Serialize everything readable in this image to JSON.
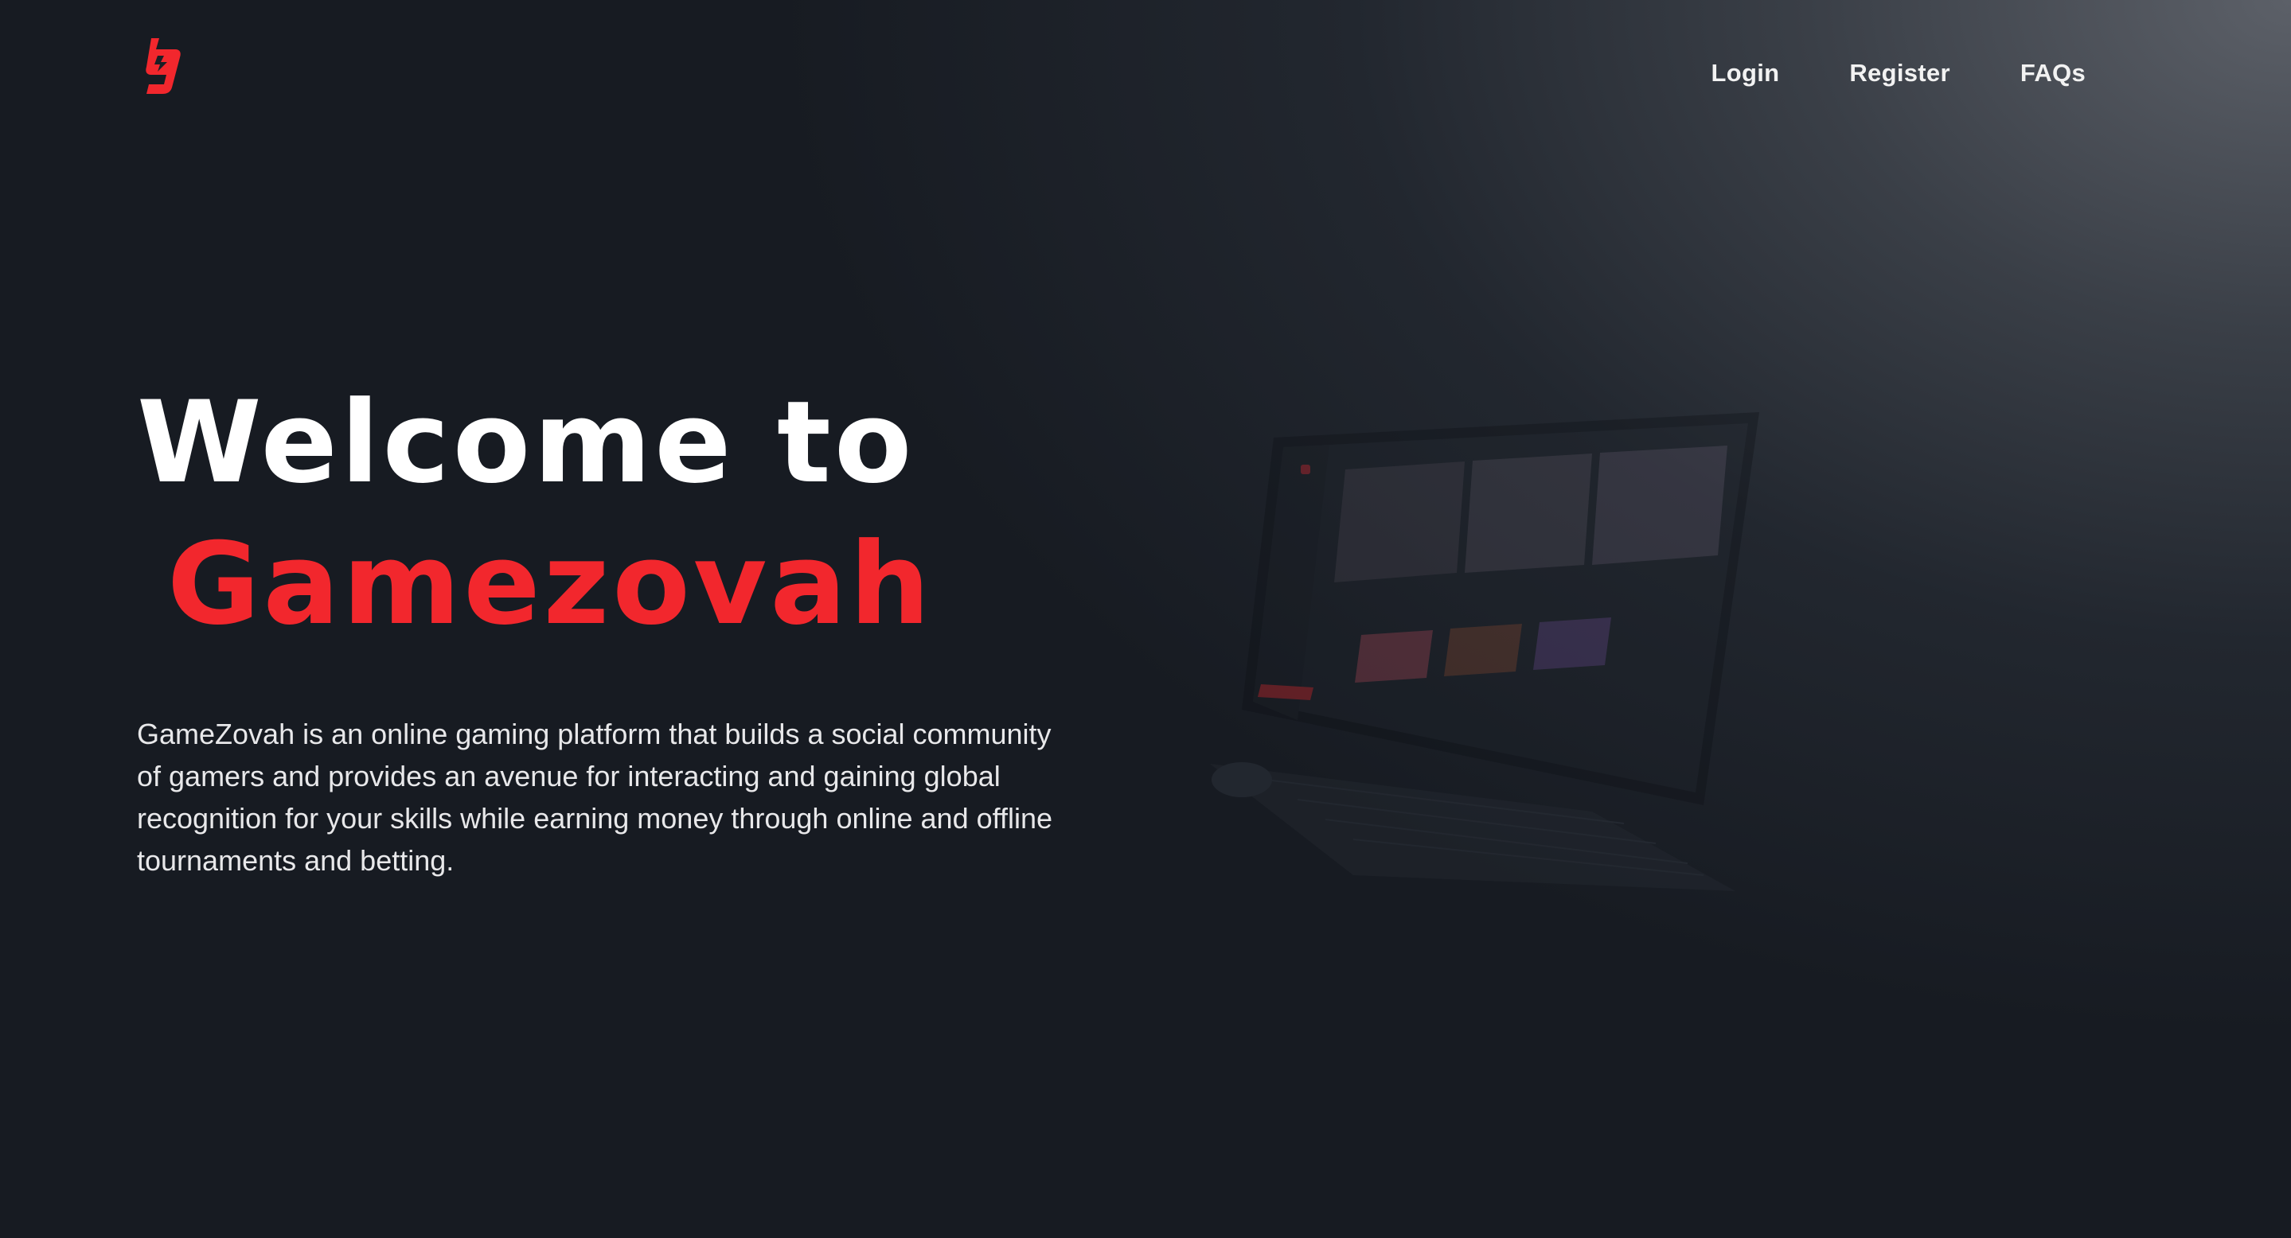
{
  "brand": {
    "name": "Gamezovah",
    "logo_icon": "gamezovah-logo-icon",
    "accent_color": "#f2272d"
  },
  "nav": {
    "items": [
      {
        "label": "Login"
      },
      {
        "label": "Register"
      },
      {
        "label": "FAQs"
      }
    ]
  },
  "hero": {
    "title_line1": "Welcome to",
    "title_line2": "Gamezovah",
    "description": "GameZovah is an online gaming platform that builds a social community of gamers and provides an avenue for interacting and gaining global recognition for your skills while earning money through online and offline tournaments and betting."
  },
  "illustration": {
    "icon": "laptop-mockup-icon"
  }
}
